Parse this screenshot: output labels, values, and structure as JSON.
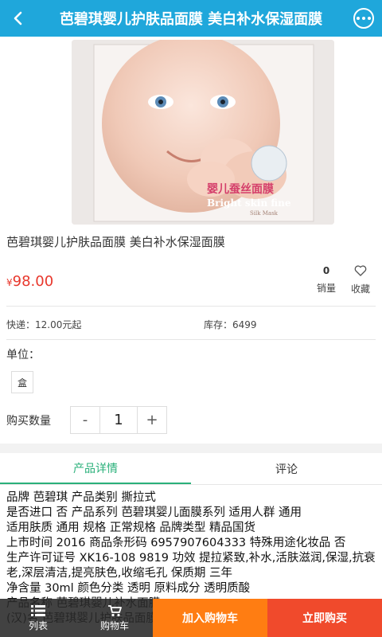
{
  "header": {
    "title": "芭碧琪婴儿护肤品面膜 美白补水保湿面膜",
    "back_icon": "chevron-left-icon",
    "menu_icon": "more-dots-icon"
  },
  "product": {
    "image_alt": "baby face mask package",
    "image_text": "婴儿蚕丝面膜",
    "image_text_en": "Bright skin fine",
    "image_text_small": "Silk Mask",
    "name": "芭碧琪婴儿护肤品面膜 美白补水保湿面膜",
    "currency": "¥",
    "price": "98.00",
    "sales_count": "0",
    "sales_label": "销量",
    "favorite_label": "收藏",
    "shipping": "快递：12.00元起",
    "stock": "库存：6499"
  },
  "options": {
    "unit_label": "单位：",
    "unit_value": "盒",
    "quantity_label": "购买数量",
    "minus": "-",
    "quantity": "1",
    "plus": "+"
  },
  "tabs": [
    {
      "label": "产品详情",
      "active": true
    },
    {
      "label": "评论",
      "active": false
    }
  ],
  "details": "品牌 芭碧琪 产品类别 撕拉式\n是否进口 否 产品系列 芭碧琪婴儿面膜系列 适用人群 通用\n适用肤质 通用 规格 正常规格 品牌类型 精品国货\n上市时间 2016 商品条形码 6957907604333 特殊用途化妆品 否\n生产许可证号 XK16-108 9819 功效 提拉紧致,补水,活肤滋润,保湿,抗衰老,深层清洁,提亮肤色,收缩毛孔 保质期 三年\n净含量 30ml 颜色分类 透明 原料成分 透明质酸\n产品名称 芭碧琪婴儿补水面膜\n(汉)名 芭碧琪婴儿护肤品面膜",
  "bottom_bar": {
    "list_label": "列表",
    "cart_label": "购物车",
    "add_cart": "加入购物车",
    "buy_now": "立即购买"
  },
  "colors": {
    "header": "#1fa7db",
    "price": "#e8372c",
    "tab_active": "#2ab07a",
    "add_cart": "#ff7d12",
    "buy_now": "#f04a2c"
  }
}
